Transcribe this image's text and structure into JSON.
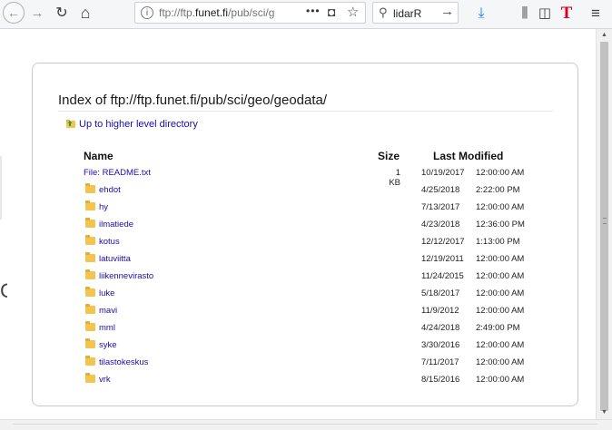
{
  "toolbar": {
    "back_glyph": "←",
    "forward_glyph": "→",
    "reload_glyph": "↻",
    "home_glyph": "⌂",
    "url_info_glyph": "i",
    "url_prefix": "ftp://ftp.",
    "url_domain": "funet.fi",
    "url_suffix": "/pub/sci/g",
    "url_more": "•••",
    "pocket_glyph": "◘",
    "star_glyph": "☆",
    "search_icon": "⚲",
    "search_text": "lidarR",
    "search_go": "→",
    "download_glyph": "⤓",
    "library_glyph": "⫼",
    "sidebar_glyph": "◫",
    "t_glyph": "T",
    "menu_glyph": "≡"
  },
  "page": {
    "title": "Index of ftp://ftp.funet.fi/pub/sci/geo/geodata/",
    "up_link": "Up to higher level directory",
    "headers": {
      "name": "Name",
      "size": "Size",
      "modified": "Last Modified"
    },
    "rows": [
      {
        "prefix": "File:",
        "name": "README.txt",
        "size": "1 KB",
        "date": "10/19/2017",
        "time": "12:00:00 AM",
        "type": "file"
      },
      {
        "prefix": "",
        "name": "ehdot",
        "size": "",
        "date": "4/25/2018",
        "time": "2:22:00 PM",
        "type": "folder"
      },
      {
        "prefix": "",
        "name": "hy",
        "size": "",
        "date": "7/13/2017",
        "time": "12:00:00 AM",
        "type": "folder"
      },
      {
        "prefix": "",
        "name": "ilmatiede",
        "size": "",
        "date": "4/23/2018",
        "time": "12:36:00 PM",
        "type": "folder"
      },
      {
        "prefix": "",
        "name": "kotus",
        "size": "",
        "date": "12/12/2017",
        "time": "1:13:00 PM",
        "type": "folder"
      },
      {
        "prefix": "",
        "name": "latuviitta",
        "size": "",
        "date": "12/19/2011",
        "time": "12:00:00 AM",
        "type": "folder"
      },
      {
        "prefix": "",
        "name": "liikennevirasto",
        "size": "",
        "date": "11/24/2015",
        "time": "12:00:00 AM",
        "type": "folder"
      },
      {
        "prefix": "",
        "name": "luke",
        "size": "",
        "date": "5/18/2017",
        "time": "12:00:00 AM",
        "type": "folder"
      },
      {
        "prefix": "",
        "name": "mavi",
        "size": "",
        "date": "11/9/2012",
        "time": "12:00:00 AM",
        "type": "folder"
      },
      {
        "prefix": "",
        "name": "mml",
        "size": "",
        "date": "4/24/2018",
        "time": "2:49:00 PM",
        "type": "folder"
      },
      {
        "prefix": "",
        "name": "syke",
        "size": "",
        "date": "3/30/2016",
        "time": "12:00:00 AM",
        "type": "folder"
      },
      {
        "prefix": "",
        "name": "tilastokeskus",
        "size": "",
        "date": "7/11/2017",
        "time": "12:00:00 AM",
        "type": "folder"
      },
      {
        "prefix": "",
        "name": "vrk",
        "size": "",
        "date": "8/15/2016",
        "time": "12:00:00 AM",
        "type": "folder"
      }
    ]
  },
  "scrollbar": {
    "up_glyph": "▲",
    "down_glyph": "▼"
  },
  "background": {
    "glyph": "C"
  },
  "colors": {
    "link": "#1a0dab",
    "folder": "#f4c450",
    "download": "#0a84ff",
    "t_icon": "#d70022"
  }
}
